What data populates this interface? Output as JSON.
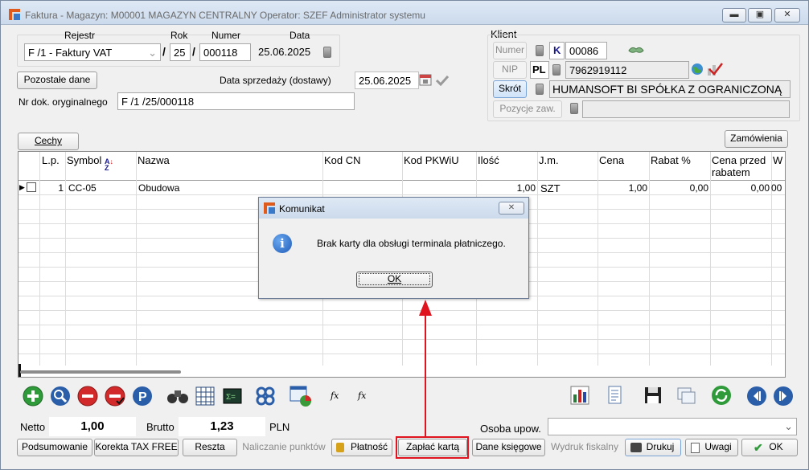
{
  "window": {
    "title": "Faktura - Magazyn: M00001 MAGAZYN CENTRALNY  Operator: SZEF Administrator systemu",
    "minimize_symbol": "▬",
    "maximize_symbol": "▣",
    "close_symbol": "✕"
  },
  "header": {
    "rejestr_label": "Rejestr",
    "rok_label": "Rok",
    "numer_label": "Numer",
    "data_label": "Data",
    "rejestr_value": "F /1   - Faktury VAT",
    "slash1": "/",
    "rok_value": "25",
    "slash2": "/",
    "numer_value": "000118",
    "data_value": "25.06.2025",
    "pozostale_label": "Pozostałe dane",
    "data_sprzedazy_label": "Data sprzedaży (dostawy)",
    "data_sprzedazy_value": "25.06.2025",
    "nr_dok_label": "Nr dok. oryginalnego",
    "nr_dok_value": "F /1  /25/000118"
  },
  "klient": {
    "group_label": "Klient",
    "numer_button": "Numer",
    "k_code": "K",
    "numer_value": "00086",
    "nip_button": "NIP",
    "country_code": "PL",
    "nip_value": "7962919112",
    "skrot_button": "Skrót",
    "skrot_value": "HUMANSOFT BI SPÓŁKA Z OGRANICZONĄ",
    "pozycje_button": "Pozycje zaw.",
    "pozycje_value": ""
  },
  "cechy_button": "Cechy",
  "zamowienia_button": "Zamówienia",
  "grid": {
    "columns": [
      "L.p.",
      "Symbol",
      "Nazwa",
      "Kod CN",
      "Kod PKWiU",
      "Ilość",
      "J.m.",
      "Cena",
      "Rabat %",
      "Cena przed rabatem",
      "W"
    ],
    "sort_icon_text": "A↓Z",
    "rows": [
      {
        "lp": "1",
        "symbol": "CC-05",
        "nazwa": "Obudowa",
        "kod_cn": "",
        "kod_pkwiu": "",
        "ilosc": "1,00",
        "jm": "SZT",
        "cena": "1,00",
        "rabat": "0,00",
        "cena_przed": "0,00",
        "w": "00"
      }
    ]
  },
  "toolbar": {
    "fx1": "fx",
    "fx2": "fx",
    "p_icon": "P"
  },
  "totals": {
    "netto_label": "Netto",
    "netto_value": "1,00",
    "brutto_label": "Brutto",
    "brutto_value": "1,23",
    "currency": "PLN",
    "osoba_label": "Osoba upow.",
    "osoba_value": ""
  },
  "bottom_buttons": {
    "podsumowanie": "Podsumowanie",
    "korekta": "Korekta TAX FREE",
    "reszta": "Reszta",
    "naliczanie": "Naliczanie punktów",
    "platnosc": "Płatność",
    "zaplac": "Zapłać kartą",
    "dane_ksiegowe": "Dane księgowe",
    "wydruk": "Wydruk fiskalny",
    "drukuj": "Drukuj",
    "uwagi": "Uwagi",
    "ok": "OK"
  },
  "dialog": {
    "title": "Komunikat",
    "message": "Brak karty dla obsługi terminala płatniczego.",
    "ok_button": "OK",
    "close_symbol": "✕",
    "info_symbol": "i"
  },
  "colors": {
    "highlight_red": "#e0141e",
    "titlebar": "#cbdaec",
    "k_blue": "#1a1a8c"
  }
}
